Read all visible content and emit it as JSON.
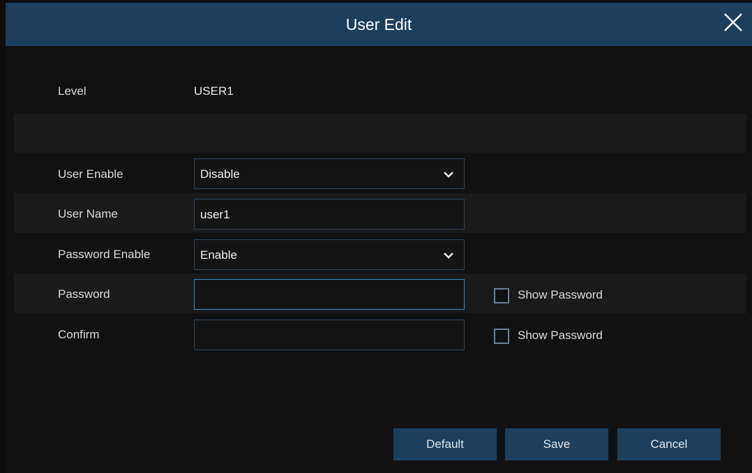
{
  "dialog": {
    "title": "User Edit",
    "close_icon": "close-icon"
  },
  "level": {
    "label": "Level",
    "value": "USER1"
  },
  "user_enable": {
    "label": "User Enable",
    "value": "Disable"
  },
  "user_name": {
    "label": "User Name",
    "value": "user1"
  },
  "password_enable": {
    "label": "Password Enable",
    "value": "Enable"
  },
  "password": {
    "label": "Password",
    "value": "",
    "show_label": "Show Password"
  },
  "confirm": {
    "label": "Confirm",
    "value": "",
    "show_label": "Show Password"
  },
  "buttons": {
    "default": "Default",
    "save": "Save",
    "cancel": "Cancel"
  },
  "colors": {
    "titlebar": "#1c3f5e",
    "focus_border": "#3d86c5",
    "field_border": "#2a4660"
  }
}
